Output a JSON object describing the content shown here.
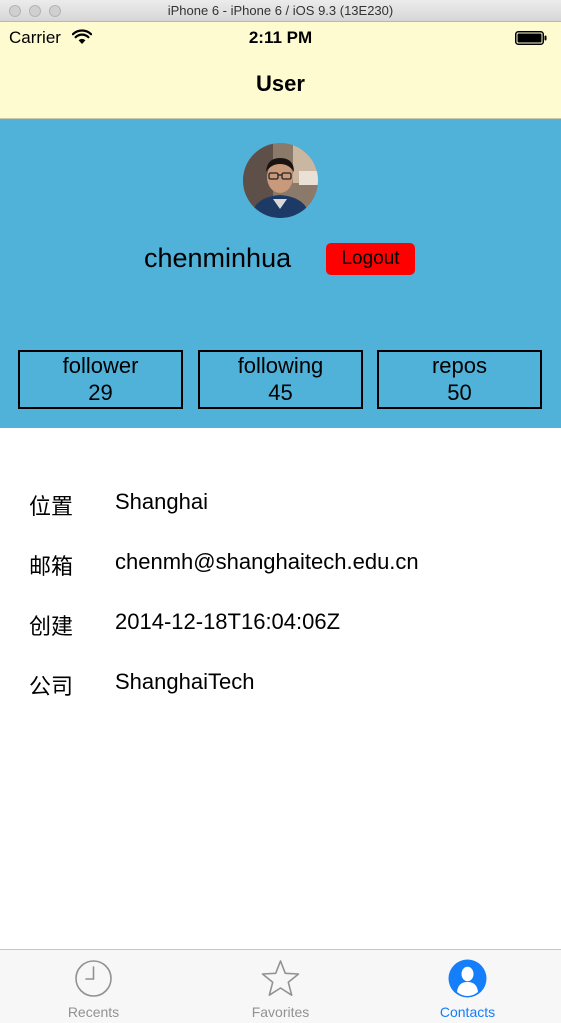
{
  "window": {
    "title": "iPhone 6 - iPhone 6 / iOS 9.3 (13E230)"
  },
  "status_bar": {
    "carrier": "Carrier",
    "time": "2:11 PM"
  },
  "nav": {
    "title": "User"
  },
  "profile": {
    "username": "chenminhua",
    "logout_label": "Logout",
    "stats": [
      {
        "label": "follower",
        "value": "29"
      },
      {
        "label": "following",
        "value": "45"
      },
      {
        "label": "repos",
        "value": "50"
      }
    ]
  },
  "info": [
    {
      "key": "位置",
      "value": "Shanghai"
    },
    {
      "key": "邮箱",
      "value": "chenmh@shanghaitech.edu.cn"
    },
    {
      "key": "创建",
      "value": "2014-12-18T16:04:06Z"
    },
    {
      "key": "公司",
      "value": "ShanghaiTech"
    }
  ],
  "tabs": [
    {
      "label": "Recents",
      "icon": "clock-icon",
      "selected": false
    },
    {
      "label": "Favorites",
      "icon": "star-icon",
      "selected": false
    },
    {
      "label": "Contacts",
      "icon": "contacts-icon",
      "selected": true
    }
  ],
  "colors": {
    "nav_background": "#fffbd1",
    "profile_background": "#50b1d9",
    "logout_button": "#ff0000",
    "tab_selected": "#147efb",
    "tab_unselected": "#929292"
  }
}
